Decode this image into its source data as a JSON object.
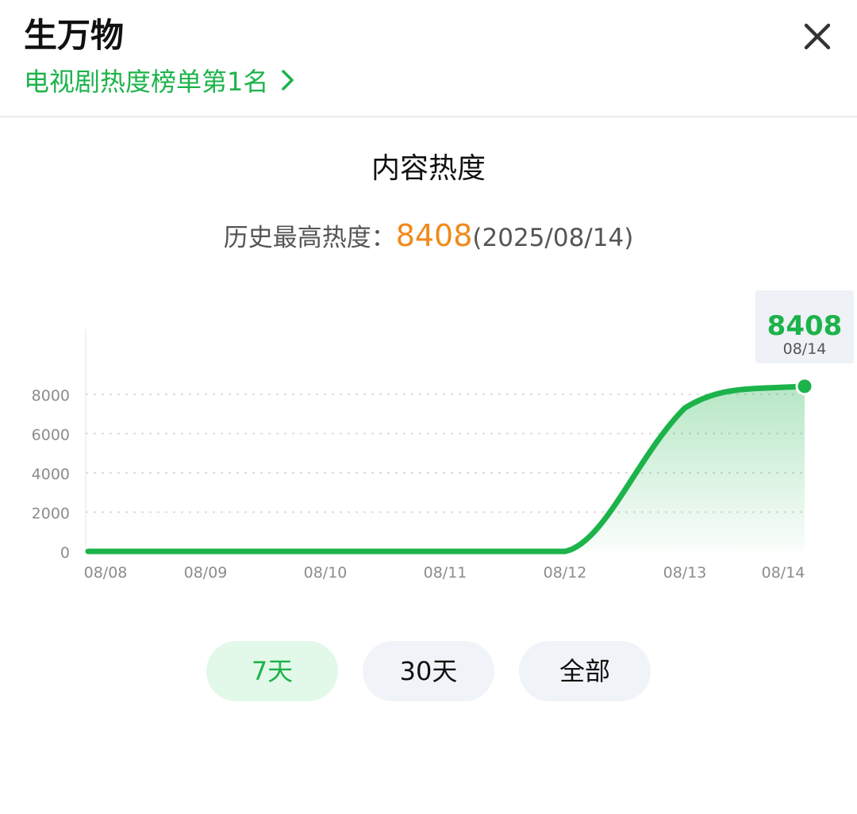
{
  "header": {
    "title": "生万物",
    "rank_link_label": "电视剧热度榜单第1名",
    "close_icon": "close-icon"
  },
  "section": {
    "title": "内容热度"
  },
  "record": {
    "label": "历史最高热度：",
    "value": "8408",
    "date": "(2025/08/14)"
  },
  "colors": {
    "accent_green": "#1cb34a",
    "record_orange": "#f08a1c",
    "tab_bg": "#f0f3f7",
    "tab_active_bg": "#e2f8e8"
  },
  "chart_data": {
    "type": "area",
    "title": "",
    "xlabel": "",
    "ylabel": "",
    "categories": [
      "08/08",
      "08/09",
      "08/10",
      "08/11",
      "08/12",
      "08/13",
      "08/14"
    ],
    "series": [
      {
        "values": [
          0,
          0,
          0,
          0,
          0,
          7300,
          8408
        ]
      }
    ],
    "ylim": [
      0,
      8000
    ],
    "yticks": [
      0,
      2000,
      4000,
      6000,
      8000
    ],
    "grid": true,
    "line_color": "#1cb34a",
    "highlight": {
      "category": "08/14",
      "value": "8408",
      "date_label": "08/14"
    }
  },
  "range_tabs": [
    {
      "label": "7天",
      "active": true
    },
    {
      "label": "30天",
      "active": false
    },
    {
      "label": "全部",
      "active": false
    }
  ]
}
